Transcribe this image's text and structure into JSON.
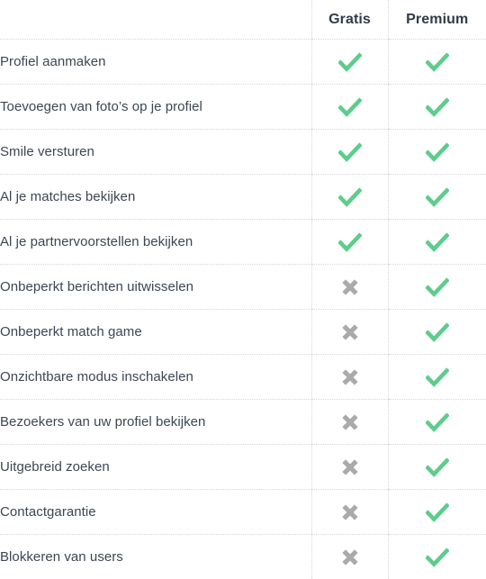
{
  "table": {
    "columns": [
      {
        "key": "feature",
        "label": ""
      },
      {
        "key": "free",
        "label": "Gratis"
      },
      {
        "key": "premium",
        "label": "Premium"
      }
    ],
    "header": {
      "feature_label": "",
      "free_label": "Gratis",
      "premium_label": "Premium"
    },
    "icons": {
      "check": "check-icon",
      "cross": "cross-icon"
    },
    "colors": {
      "check": "#5ccd8b",
      "cross": "#aaaaaa",
      "text": "#3c4653",
      "header_text": "#2f3b49",
      "grid_line": "#d3d6da",
      "background": "#ffffff"
    },
    "rows": [
      {
        "feature": "Profiel aanmaken",
        "free": "check",
        "premium": "check"
      },
      {
        "feature": "Toevoegen van foto’s op je profiel",
        "free": "check",
        "premium": "check"
      },
      {
        "feature": "Smile versturen",
        "free": "check",
        "premium": "check"
      },
      {
        "feature": "Al je matches bekijken",
        "free": "check",
        "premium": "check"
      },
      {
        "feature": "Al je partnervoorstellen bekijken",
        "free": "check",
        "premium": "check"
      },
      {
        "feature": "Onbeperkt berichten uitwisselen",
        "free": "cross",
        "premium": "check"
      },
      {
        "feature": "Onbeperkt match game",
        "free": "cross",
        "premium": "check"
      },
      {
        "feature": "Onzichtbare modus inschakelen",
        "free": "cross",
        "premium": "check"
      },
      {
        "feature": "Bezoekers van uw profiel bekijken",
        "free": "cross",
        "premium": "check"
      },
      {
        "feature": "Uitgebreid zoeken",
        "free": "cross",
        "premium": "check"
      },
      {
        "feature": "Contactgarantie",
        "free": "cross",
        "premium": "check"
      },
      {
        "feature": "Blokkeren van users",
        "free": "cross",
        "premium": "check"
      }
    ]
  }
}
